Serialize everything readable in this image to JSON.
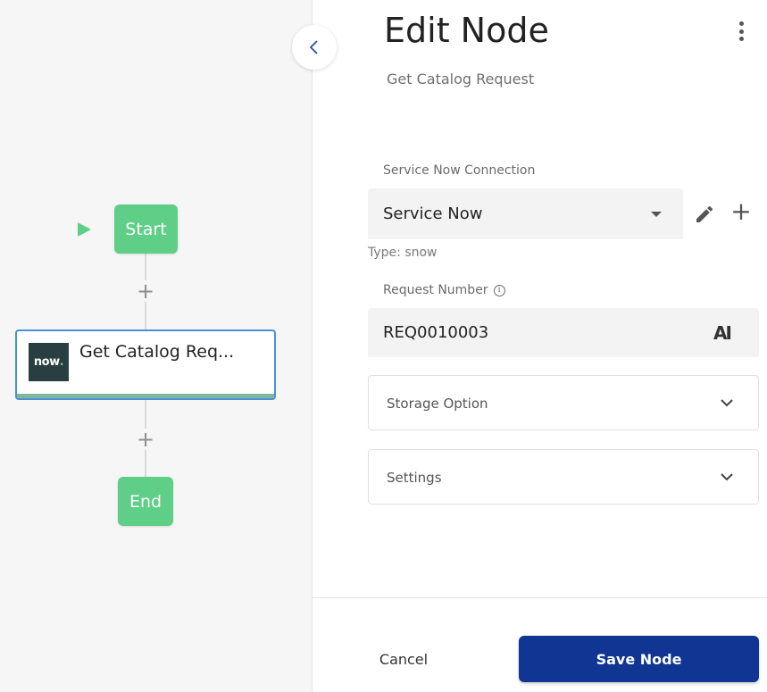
{
  "canvas": {
    "start_label": "Start",
    "end_label": "End",
    "task_node": {
      "title": "Get Catalog Req...",
      "logo_text": "now",
      "logo_dot": "."
    },
    "add_symbol": "+"
  },
  "panel": {
    "title": "Edit Node",
    "subtitle": "Get Catalog Request",
    "connection": {
      "label": "Service Now Connection",
      "value": "Service Now",
      "type_hint": "Type: snow"
    },
    "request_number": {
      "label": "Request Number",
      "value": "REQ0010003",
      "ai_label": "AI"
    },
    "storage_option": {
      "label": "Storage Option"
    },
    "settings": {
      "label": "Settings"
    },
    "footer": {
      "cancel_label": "Cancel",
      "save_label": "Save Node"
    }
  },
  "colors": {
    "accent_green": "#5fcf87",
    "primary_button": "#103592",
    "node_border": "#4a90d9",
    "servicenow_bg": "#293e40"
  },
  "icons": {
    "play": "play-icon",
    "collapse": "chevron-left-icon",
    "menu": "kebab-menu-icon",
    "edit": "pencil-icon",
    "add": "plus-icon",
    "info": "info-icon",
    "expand": "chevron-down-icon"
  }
}
